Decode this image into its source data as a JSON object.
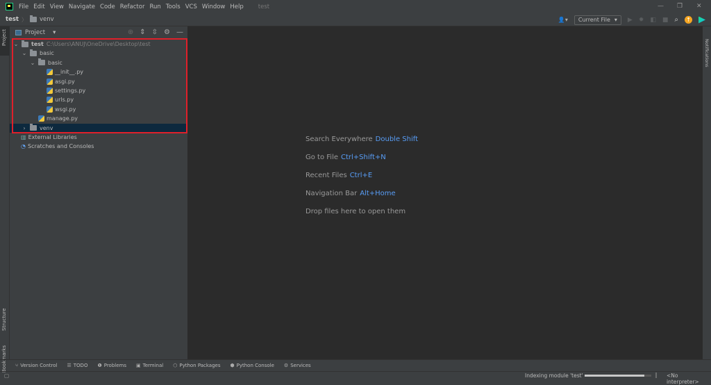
{
  "menubar": {
    "items": [
      "File",
      "Edit",
      "View",
      "Navigate",
      "Code",
      "Refactor",
      "Run",
      "Tools",
      "VCS",
      "Window",
      "Help"
    ],
    "project_title": "test"
  },
  "navbar": {
    "breadcrumb": [
      "test",
      "venv"
    ]
  },
  "toolbar": {
    "run_config": "Current File"
  },
  "left_strip": {
    "project": "Project",
    "structure": "Structure",
    "bookmarks": "Bookmarks"
  },
  "right_strip": {
    "notifications": "Notifications"
  },
  "project_panel": {
    "title": "Project",
    "tree": [
      {
        "label": "test",
        "path": "C:\\Users\\ANUJ\\OneDrive\\Desktop\\test",
        "type": "folder",
        "depth": 0,
        "expanded": true
      },
      {
        "label": "basic",
        "type": "folder",
        "depth": 1,
        "expanded": true
      },
      {
        "label": "basic",
        "type": "package",
        "depth": 2,
        "expanded": true
      },
      {
        "label": "__init__.py",
        "type": "python",
        "depth": 3
      },
      {
        "label": "asgi.py",
        "type": "python",
        "depth": 3
      },
      {
        "label": "settings.py",
        "type": "python",
        "depth": 3
      },
      {
        "label": "urls.py",
        "type": "python",
        "depth": 3
      },
      {
        "label": "wsgi.py",
        "type": "python",
        "depth": 3
      },
      {
        "label": "manage.py",
        "type": "python",
        "depth": 2
      },
      {
        "label": "venv",
        "type": "folder",
        "depth": 1,
        "expanded": false,
        "selected": true
      },
      {
        "label": "External Libraries",
        "type": "library",
        "depth": 0
      },
      {
        "label": "Scratches and Consoles",
        "type": "scratch",
        "depth": 0
      }
    ]
  },
  "editor": {
    "hints": [
      {
        "text": "Search Everywhere",
        "key": "Double Shift"
      },
      {
        "text": "Go to File",
        "key": "Ctrl+Shift+N"
      },
      {
        "text": "Recent Files",
        "key": "Ctrl+E"
      },
      {
        "text": "Navigation Bar",
        "key": "Alt+Home"
      },
      {
        "text": "Drop files here to open them",
        "key": ""
      }
    ]
  },
  "bottom_tabs": [
    "Version Control",
    "TODO",
    "Problems",
    "Terminal",
    "Python Packages",
    "Python Console",
    "Services"
  ],
  "status": {
    "indexing": "Indexing module 'test'",
    "progress_percent": 90,
    "interpreter": "<No interpreter>"
  },
  "colors": {
    "accent": "#589df6",
    "selection": "#0d293e",
    "highlight_box": "#e0202a"
  }
}
